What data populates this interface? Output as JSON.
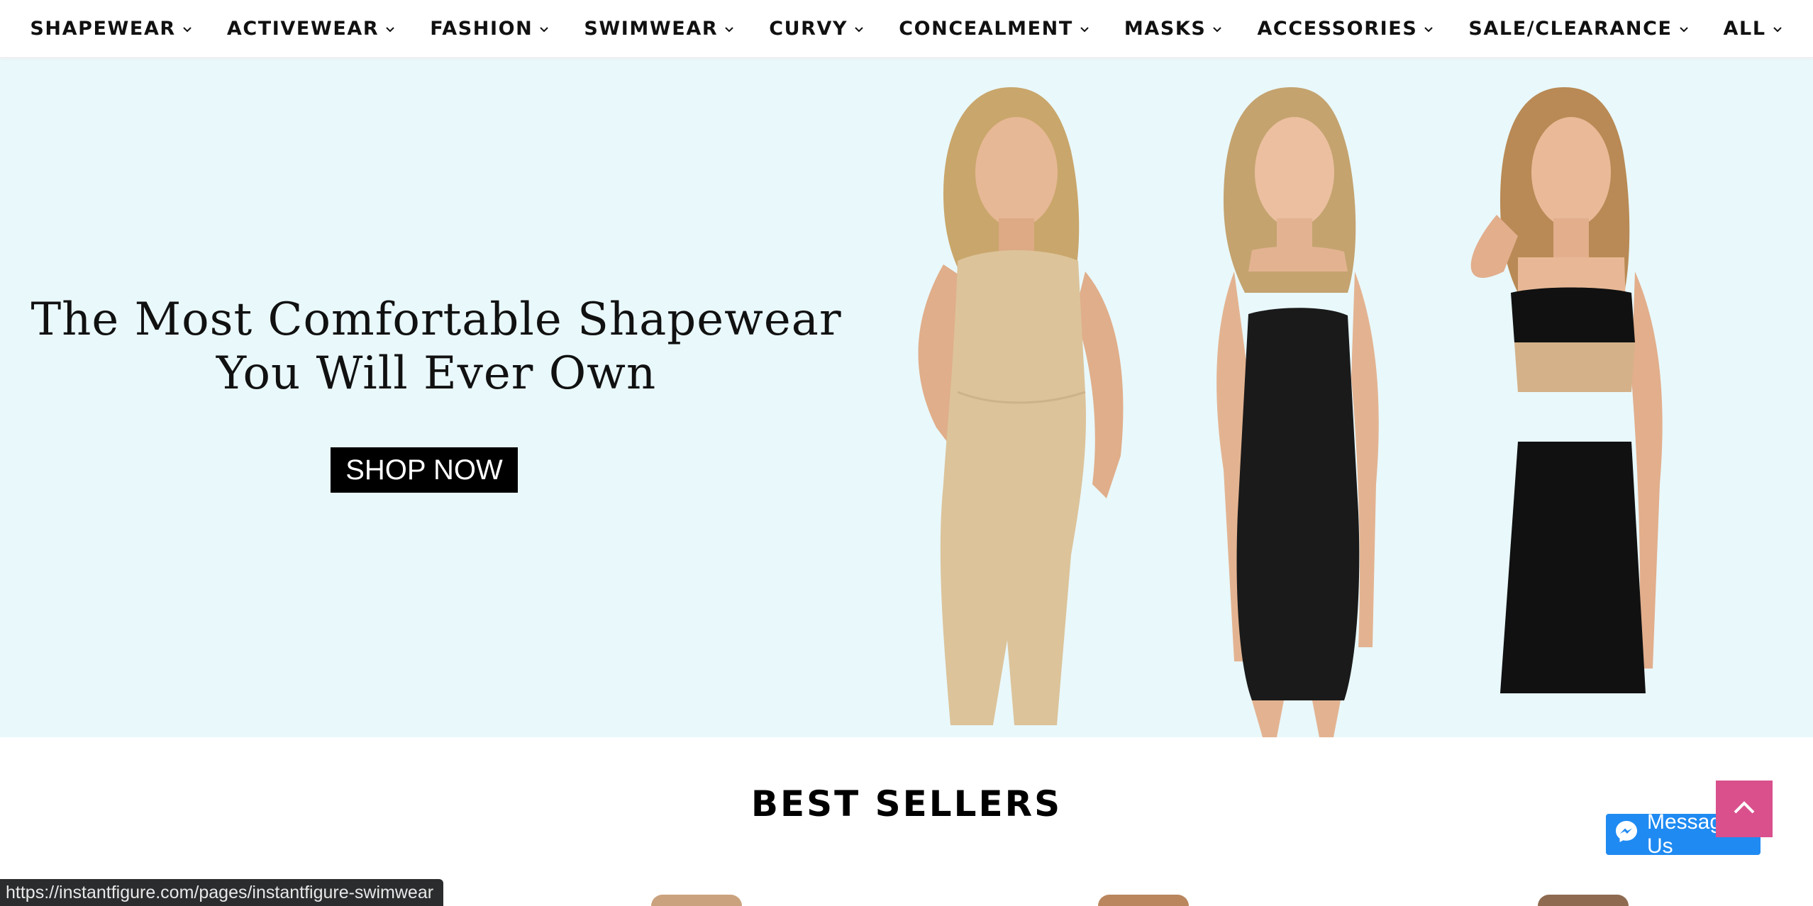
{
  "nav": {
    "items": [
      {
        "label": "SHAPEWEAR"
      },
      {
        "label": "ACTIVEWEAR"
      },
      {
        "label": "FASHION"
      },
      {
        "label": "SWIMWEAR"
      },
      {
        "label": "CURVY"
      },
      {
        "label": "CONCEALMENT"
      },
      {
        "label": "MASKS"
      },
      {
        "label": "ACCESSORIES"
      },
      {
        "label": "SALE/CLEARANCE"
      },
      {
        "label": "ALL"
      }
    ]
  },
  "hero": {
    "title_line1": "The Most Comfortable Shapewear",
    "title_line2": "You Will Ever Own",
    "cta_label": "SHOP NOW",
    "background": "#e9f8fb"
  },
  "best_sellers": {
    "heading": "BEST SELLERS"
  },
  "floating": {
    "messenger_label": "Message Us",
    "scroll_top_color": "#d9508d"
  },
  "status_bar": {
    "url": "https://instantfigure.com/pages/instantfigure-swimwear"
  },
  "icons": [
    "chevron-down-icon",
    "chevron-up-icon",
    "messenger-icon"
  ]
}
